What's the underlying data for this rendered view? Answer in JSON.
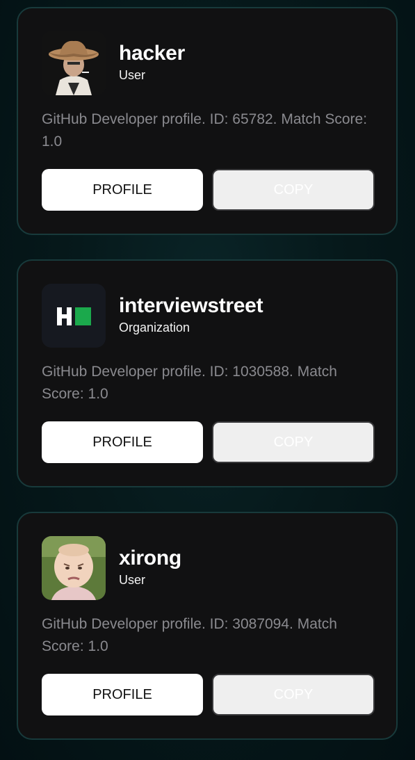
{
  "results": [
    {
      "name": "hacker",
      "kind": "User",
      "description": "GitHub Developer profile. ID: 65782. Match Score: 1.0",
      "profile_label": "PROFILE",
      "copy_label": "COPY",
      "avatar_icon": "cowboy-avatar-icon"
    },
    {
      "name": "interviewstreet",
      "kind": "Organization",
      "description": "GitHub Developer profile. ID: 1030588. Match Score: 1.0",
      "profile_label": "PROFILE",
      "copy_label": "COPY",
      "avatar_icon": "hackerrank-logo-icon"
    },
    {
      "name": "xirong",
      "kind": "User",
      "description": "GitHub Developer profile. ID: 3087094. Match Score: 1.0",
      "profile_label": "PROFILE",
      "copy_label": "COPY",
      "avatar_icon": "baby-avatar-icon"
    }
  ],
  "colors": {
    "background": "#06191b",
    "card": "#111112",
    "card_border": "#183a3b",
    "logo_green": "#1ba94c"
  }
}
